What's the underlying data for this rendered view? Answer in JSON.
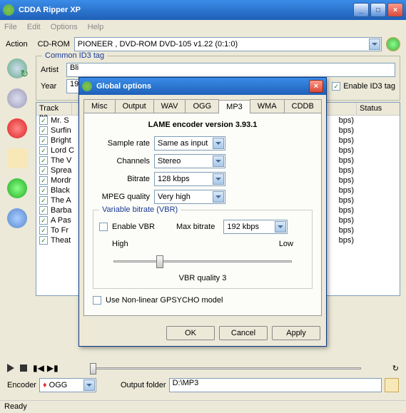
{
  "window": {
    "title": "CDDA Ripper XP"
  },
  "menu": {
    "file": "File",
    "edit": "Edit",
    "options": "Options",
    "help": "Help"
  },
  "toolbar": {
    "action": "Action",
    "cdrom": "CD-ROM",
    "cdrom_value": "PIONEER , DVD-ROM DVD-105  v1.22 (0:1:0)"
  },
  "id3": {
    "legend": "Common ID3 tag",
    "artist_label": "Artist",
    "artist_value": "Bli",
    "year_label": "Year",
    "year_value": "19",
    "enable_label": "Enable ID3 tag"
  },
  "list": {
    "col_name": "Track na",
    "col_status": "Status",
    "items": [
      {
        "name": "Mr. S",
        "ext": "bps)"
      },
      {
        "name": "Surfin",
        "ext": "bps)"
      },
      {
        "name": "Bright",
        "ext": "bps)"
      },
      {
        "name": "Lord C",
        "ext": "bps)"
      },
      {
        "name": "The V",
        "ext": "bps)"
      },
      {
        "name": "Sprea",
        "ext": "bps)"
      },
      {
        "name": "Mordr",
        "ext": "bps)"
      },
      {
        "name": "Black",
        "ext": "bps)"
      },
      {
        "name": "The A",
        "ext": "bps)"
      },
      {
        "name": "Barba",
        "ext": "bps)"
      },
      {
        "name": "A Pas",
        "ext": "bps)"
      },
      {
        "name": "To Fr",
        "ext": "bps)"
      },
      {
        "name": "Theat",
        "ext": "bps)"
      }
    ]
  },
  "bottom": {
    "encoder_label": "Encoder",
    "encoder_value": "OGG",
    "output_label": "Output folder",
    "output_value": "D:\\MP3"
  },
  "status": {
    "text": "Ready"
  },
  "dialog": {
    "title": "Global options",
    "tabs": [
      "Misc",
      "Output",
      "WAV",
      "OGG",
      "MP3",
      "WMA",
      "CDDB"
    ],
    "active_tab": "MP3",
    "heading": "LAME encoder version 3.93.1",
    "sample_rate_label": "Sample rate",
    "sample_rate_value": "Same as input",
    "channels_label": "Channels",
    "channels_value": "Stereo",
    "bitrate_label": "Bitrate",
    "bitrate_value": "128 kbps",
    "quality_label": "MPEG quality",
    "quality_value": "Very high",
    "vbr_legend": "Variable bitrate (VBR)",
    "enable_vbr": "Enable VBR",
    "max_bitrate_label": "Max bitrate",
    "max_bitrate_value": "192 kbps",
    "high": "High",
    "low": "Low",
    "vbr_quality": "VBR quality 3",
    "gpsycho": "Use Non-linear GPSYCHO model",
    "ok": "OK",
    "cancel": "Cancel",
    "apply": "Apply"
  }
}
